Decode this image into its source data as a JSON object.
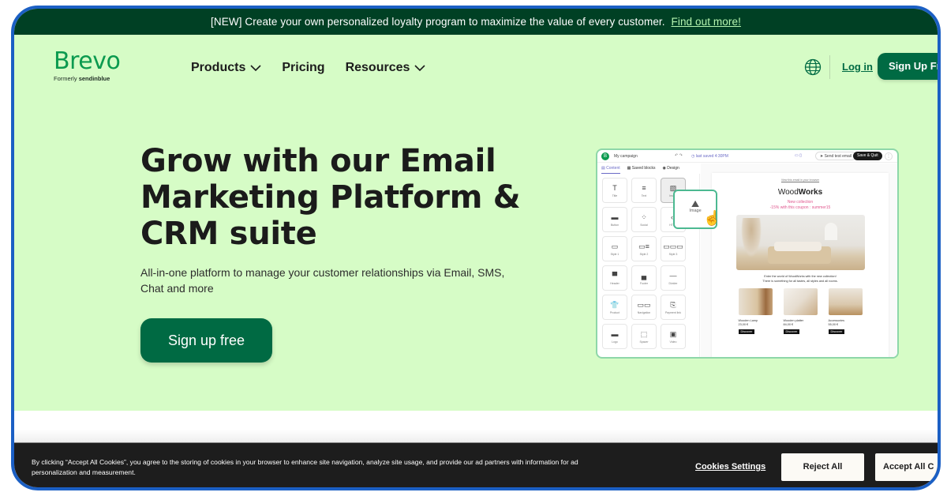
{
  "announcement": {
    "text": "[NEW] Create your own personalized loyalty program to maximize the value of every customer.",
    "link": "Find out more!"
  },
  "header": {
    "logo": "Brevo",
    "logo_sub_prefix": "Formerly",
    "logo_sub_brand": "sendinblue",
    "nav": [
      {
        "label": "Products",
        "has_dropdown": true
      },
      {
        "label": "Pricing",
        "has_dropdown": false
      },
      {
        "label": "Resources",
        "has_dropdown": true
      }
    ],
    "globe_icon": "globe-icon",
    "login": "Log in",
    "signup": "Sign Up Fr"
  },
  "hero": {
    "headline_lines": [
      "Grow with our Email",
      "Marketing Platform &",
      "CRM suite"
    ],
    "subtitle": "All-in-one platform to manage your customer relationships via Email, SMS, Chat and more",
    "cta": "Sign up free"
  },
  "editor": {
    "logo": "B",
    "campaign": "My campaign",
    "undo_redo": "↶ ↷",
    "saved": "◷ last saved 4:30PM",
    "devices": "▭ ▯",
    "send_test": "➤ Send test email",
    "save_quit": "Save & Quit",
    "more": "⋮",
    "tabs": [
      "▤ Content",
      "▦ Saved blocks",
      "◉ Design"
    ],
    "blocks": [
      {
        "glyph": "T",
        "label": "Title"
      },
      {
        "glyph": "≡",
        "label": "Text"
      },
      {
        "glyph": "▨",
        "label": "Image"
      },
      {
        "glyph": "▬",
        "label": "Button"
      },
      {
        "glyph": "⁘",
        "label": "Social"
      },
      {
        "glyph": "‹›",
        "label": "HTML"
      },
      {
        "glyph": "▭",
        "label": "Style 1"
      },
      {
        "glyph": "▭≡",
        "label": "Style 2"
      },
      {
        "glyph": "▭▭▭",
        "label": "Style 3"
      },
      {
        "glyph": "▀",
        "label": "Header"
      },
      {
        "glyph": "▄",
        "label": "Footer"
      },
      {
        "glyph": "—",
        "label": "Divider"
      },
      {
        "glyph": "👕",
        "label": "Product"
      },
      {
        "glyph": "▭▭",
        "label": "Navigation"
      },
      {
        "glyph": "⎘",
        "label": "Payment link"
      },
      {
        "glyph": "▬",
        "label": "Logo"
      },
      {
        "glyph": "⬚",
        "label": "Spacer"
      },
      {
        "glyph": "▣",
        "label": "Video"
      }
    ],
    "drag_label": "Image",
    "drag_glyph": "⛰",
    "email": {
      "view_in_browser": "View this email in your browser",
      "brand_light": "Wood",
      "brand_bold": "Works",
      "promo_line1": "New collection",
      "promo_line2": "-15% with this coupon : summer15",
      "intro_line1": "Enter the world of WoodWorks with the new collection!",
      "intro_line2": "There is something for all tastes, all styles and all rooms.",
      "products": [
        {
          "name": "Wooden Lamp",
          "price": "23,00 €",
          "button": "Discover"
        },
        {
          "name": "Wooden platter",
          "price": "84,00 €",
          "button": "Discover"
        },
        {
          "name": "Accessories",
          "price": "55,00 €",
          "button": "Discover"
        }
      ]
    }
  },
  "cookie": {
    "text": "By clicking “Accept All Cookies”, you agree to the storing of cookies in your browser to enhance site navigation, analyze site usage, and provide our ad partners with information for ad personalization and measurement.",
    "settings": "Cookies Settings",
    "reject": "Reject All",
    "accept": "Accept All C"
  },
  "colors": {
    "brand_green": "#006a43",
    "announce_bg": "#004024",
    "hero_bg": "#d6fcc6",
    "frame_border": "#1b5fc4",
    "cookie_bg": "#1d1d1d"
  }
}
